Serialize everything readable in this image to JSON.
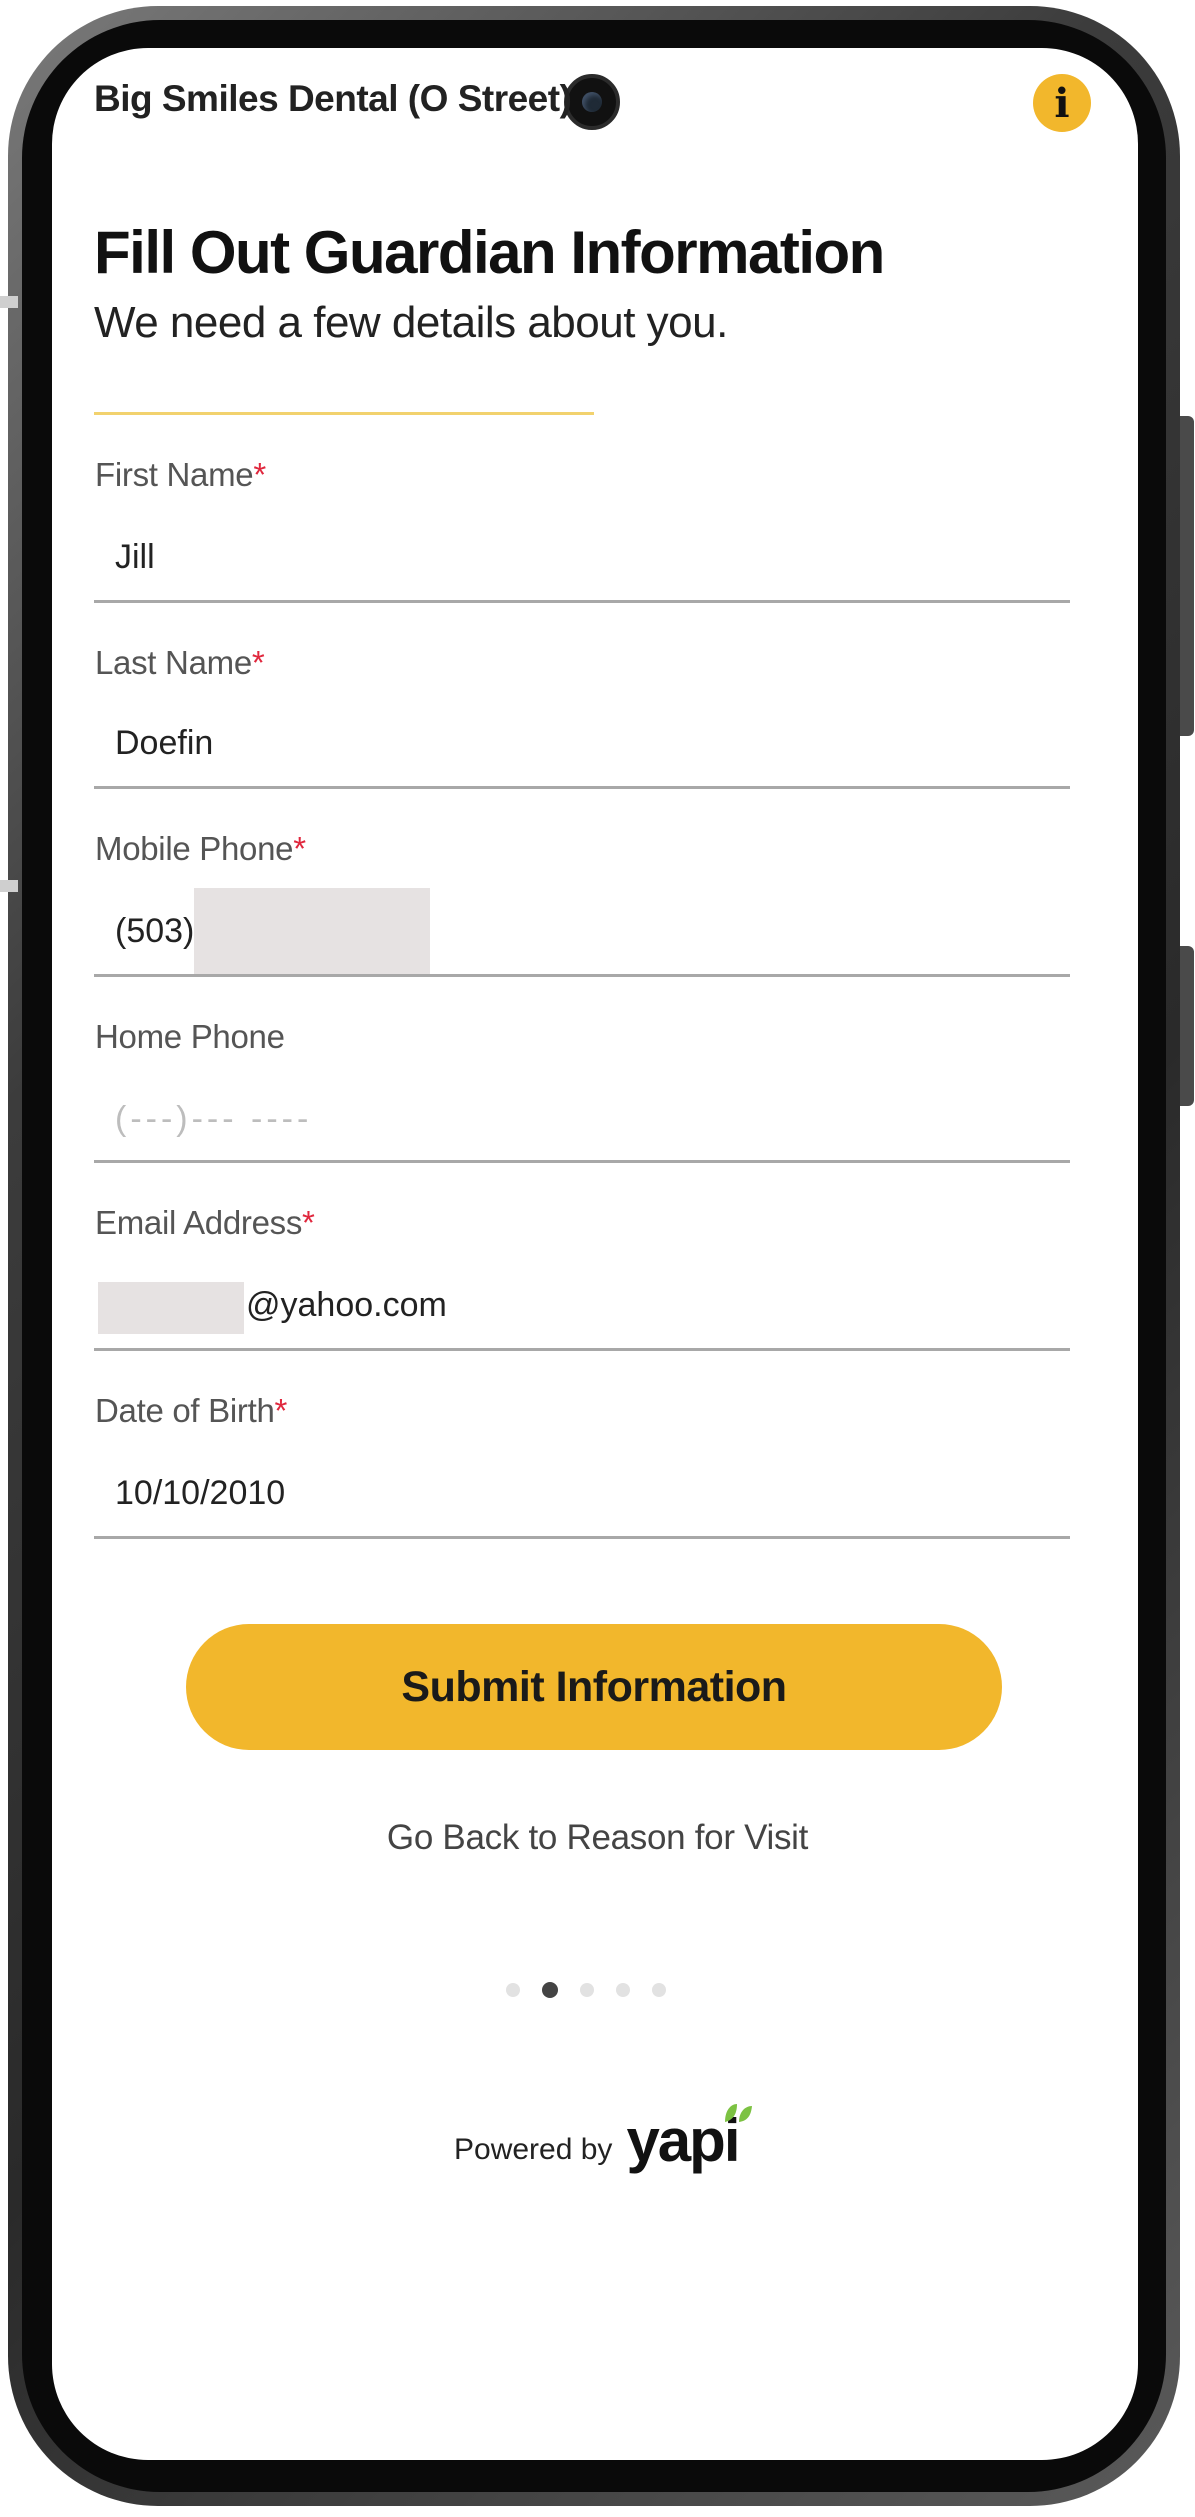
{
  "header": {
    "practice_name": "Big Smiles Dental (O Street)",
    "info_icon": "info-icon"
  },
  "page": {
    "title": "Fill Out Guardian Information",
    "subtitle": "We need a few details about you."
  },
  "form": {
    "first_name": {
      "label": "First Name",
      "required_mark": "*",
      "value": "Jill"
    },
    "last_name": {
      "label": "Last Name",
      "required_mark": "*",
      "value": "Doefin"
    },
    "mobile_phone": {
      "label": "Mobile Phone",
      "required_mark": "*",
      "value": "(503)"
    },
    "home_phone": {
      "label": "Home Phone",
      "placeholder": "(---)--- ----"
    },
    "email": {
      "label": "Email Address",
      "required_mark": "*",
      "value": "@yahoo.com"
    },
    "dob": {
      "label": "Date of Birth",
      "required_mark": "*",
      "value": "10/10/2010"
    }
  },
  "actions": {
    "submit_label": "Submit Information",
    "back_label": "Go Back to Reason for Visit"
  },
  "pagination": {
    "total": 5,
    "active_index": 1
  },
  "footer": {
    "powered_by": "Powered by",
    "brand": "yapi"
  },
  "colors": {
    "accent": "#f2b72c",
    "required": "#e0273d",
    "leaf": "#7cc242"
  }
}
